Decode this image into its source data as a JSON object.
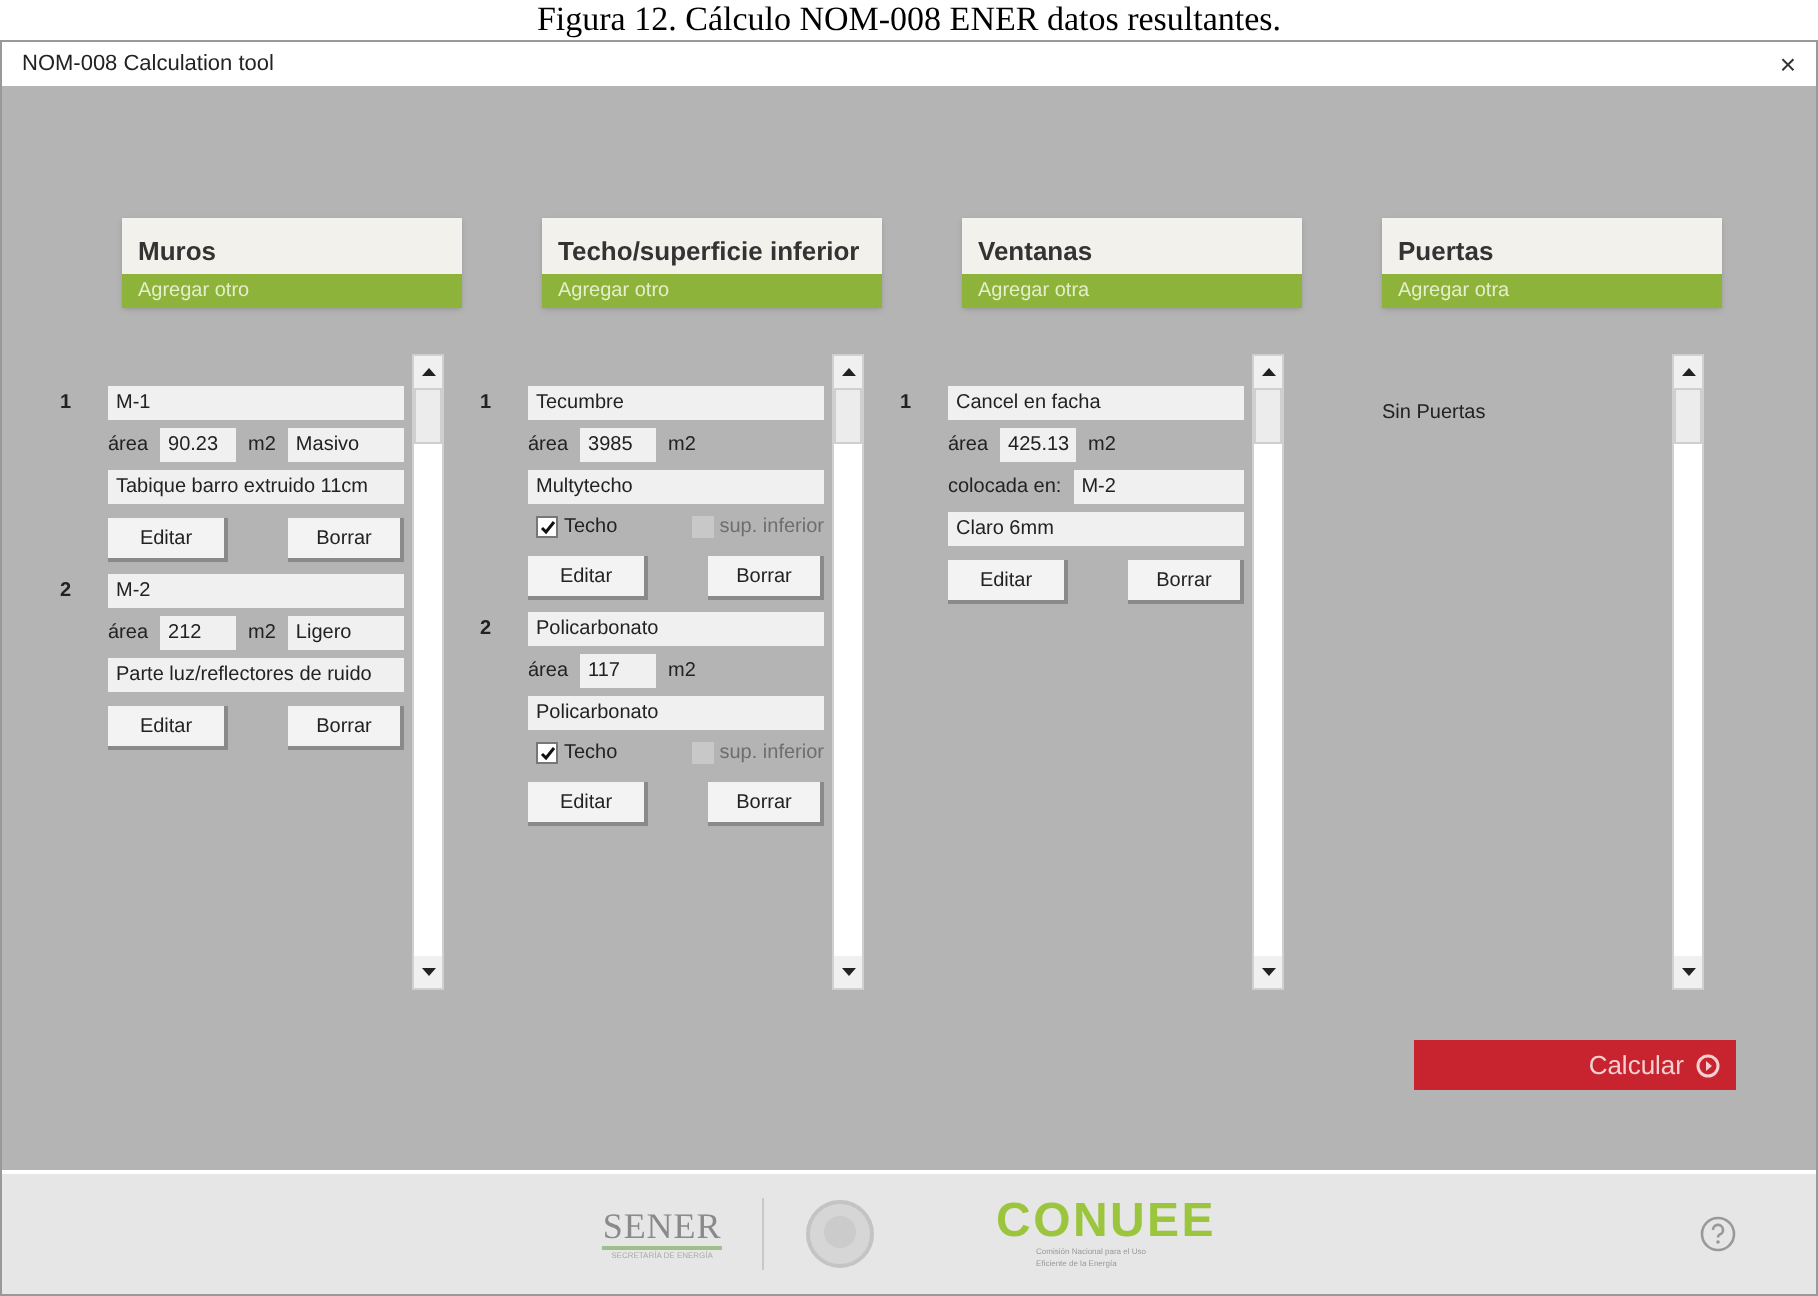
{
  "caption": "Figura 12. Cálculo NOM-008 ENER datos resultantes.",
  "window": {
    "title": "NOM-008 Calculation tool",
    "close": "×"
  },
  "sections": [
    {
      "title": "Muros",
      "add": "Agregar otro",
      "items": [
        {
          "kind": "muro",
          "number": "1",
          "name": "M-1",
          "area_label": "área",
          "area": "90.23",
          "unit": "m2",
          "type": "Masivo",
          "description": "Tabique barro extruido 11cm",
          "edit": "Editar",
          "delete": "Borrar"
        },
        {
          "kind": "muro",
          "number": "2",
          "name": "M-2",
          "area_label": "área",
          "area": "212",
          "unit": "m2",
          "type": "Ligero",
          "description": "Parte luz/reflectores de ruido",
          "edit": "Editar",
          "delete": "Borrar"
        }
      ]
    },
    {
      "title": "Techo/superficie inferior",
      "add": "Agregar otro",
      "items": [
        {
          "kind": "techo",
          "number": "1",
          "name": "Tecumbre",
          "area_label": "área",
          "area": "3985",
          "unit": "m2",
          "material": "Multytecho",
          "checks": [
            {
              "label": "Techo",
              "checked": true,
              "disabled": false
            },
            {
              "label": "sup. inferior",
              "checked": false,
              "disabled": true
            }
          ],
          "edit": "Editar",
          "delete": "Borrar"
        },
        {
          "kind": "techo",
          "number": "2",
          "name": "Policarbonato",
          "area_label": "área",
          "area": "117",
          "unit": "m2",
          "material": "Policarbonato",
          "checks": [
            {
              "label": "Techo",
              "checked": true,
              "disabled": false
            },
            {
              "label": "sup. inferior",
              "checked": false,
              "disabled": true
            }
          ],
          "edit": "Editar",
          "delete": "Borrar"
        }
      ]
    },
    {
      "title": "Ventanas",
      "add": "Agregar otra",
      "items": [
        {
          "kind": "ventana",
          "number": "1",
          "name": "Cancel en facha",
          "area_label": "área",
          "area": "425.13",
          "unit": "m2",
          "placed_label": "colocada en:",
          "placed": "M-2",
          "glass": "Claro 6mm",
          "edit": "Editar",
          "delete": "Borrar"
        }
      ]
    },
    {
      "title": "Puertas",
      "add": "Agregar otra",
      "empty": "Sin Puertas"
    }
  ],
  "calculate": "Calcular",
  "footer": {
    "sener": "SENER",
    "sener_sub": "SECRETARÍA DE ENERGÍA",
    "conuee": "CONUEE",
    "conuee_sub": "Comisión Nacional para el Uso Eficiente de la Energía"
  }
}
